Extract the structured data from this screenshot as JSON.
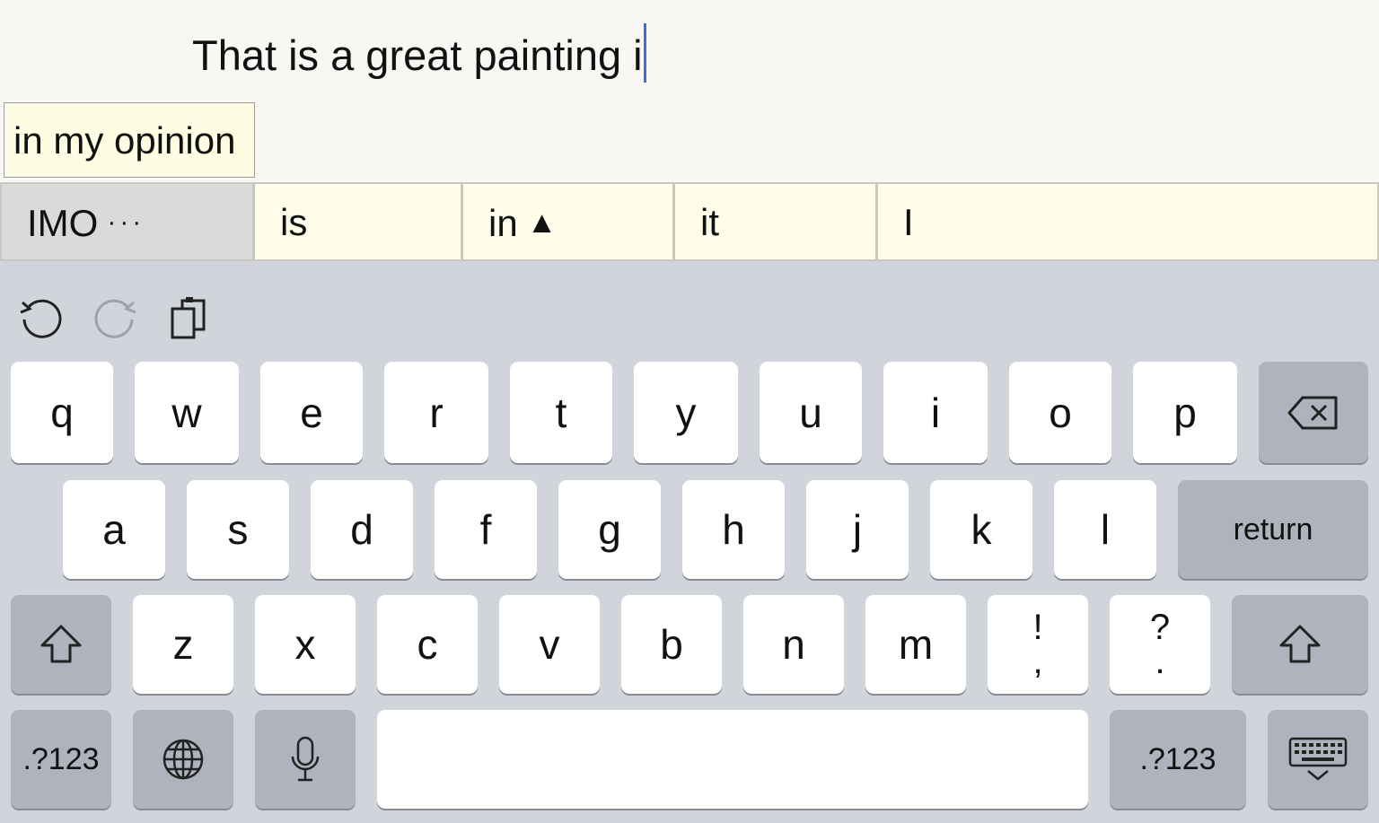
{
  "editor": {
    "typed_text": "That is a great painting i",
    "expansion_suggestion": "in my opinion"
  },
  "predictions": [
    {
      "label": "IMO",
      "extra": "···"
    },
    {
      "label": "is"
    },
    {
      "label": "in",
      "extra": "▲"
    },
    {
      "label": "it"
    },
    {
      "label": "I"
    }
  ],
  "toolbar": {
    "undo_icon": "undo-icon",
    "redo_icon": "redo-icon",
    "paste_icon": "paste-icon"
  },
  "keyboard": {
    "row1": [
      "q",
      "w",
      "e",
      "r",
      "t",
      "y",
      "u",
      "i",
      "o",
      "p"
    ],
    "row2": [
      "a",
      "s",
      "d",
      "f",
      "g",
      "h",
      "j",
      "k",
      "l"
    ],
    "row3": [
      "z",
      "x",
      "c",
      "v",
      "b",
      "n",
      "m"
    ],
    "punct1": {
      "top": "!",
      "bottom": ","
    },
    "punct2": {
      "top": "?",
      "bottom": "."
    },
    "return_label": "return",
    "numbers_label_left": ".?123",
    "numbers_label_right": ".?123",
    "space_label": ""
  },
  "colors": {
    "cursor": "#3f6ddc",
    "suggestion_bg": "#fefeeb",
    "keyboard_bg": "#d1d4da",
    "function_key_bg": "#aeb3bd"
  }
}
